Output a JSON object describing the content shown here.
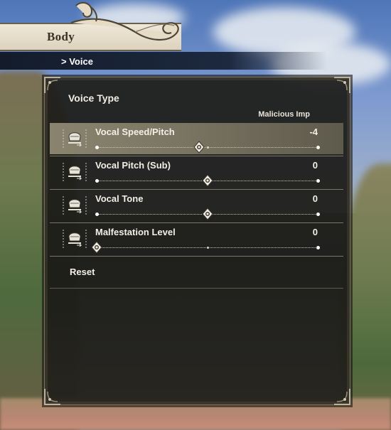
{
  "header": {
    "title": "Body"
  },
  "breadcrumb": {
    "label": "> Voice"
  },
  "voice_type": {
    "title": "Voice Type",
    "value": "Malicious Imp"
  },
  "sliders": [
    {
      "label": "Vocal Speed/Pitch",
      "value": "-4",
      "fraction": 0.46,
      "selected": true,
      "icon": "voice-speed-icon"
    },
    {
      "label": "Vocal Pitch (Sub)",
      "value": "0",
      "fraction": 0.5,
      "selected": false,
      "icon": "voice-pitch-icon"
    },
    {
      "label": "Vocal Tone",
      "value": "0",
      "fraction": 0.5,
      "selected": false,
      "icon": "voice-tone-icon"
    },
    {
      "label": "Malfestation Level",
      "value": "0",
      "fraction": 0.0,
      "selected": false,
      "icon": "malfestation-icon"
    }
  ],
  "reset": {
    "label": "Reset"
  },
  "colors": {
    "panel": "#1e1d1a",
    "accent_frame": "#7a6f58",
    "selected_row": "#8a846f",
    "text": "#f3efe6"
  }
}
